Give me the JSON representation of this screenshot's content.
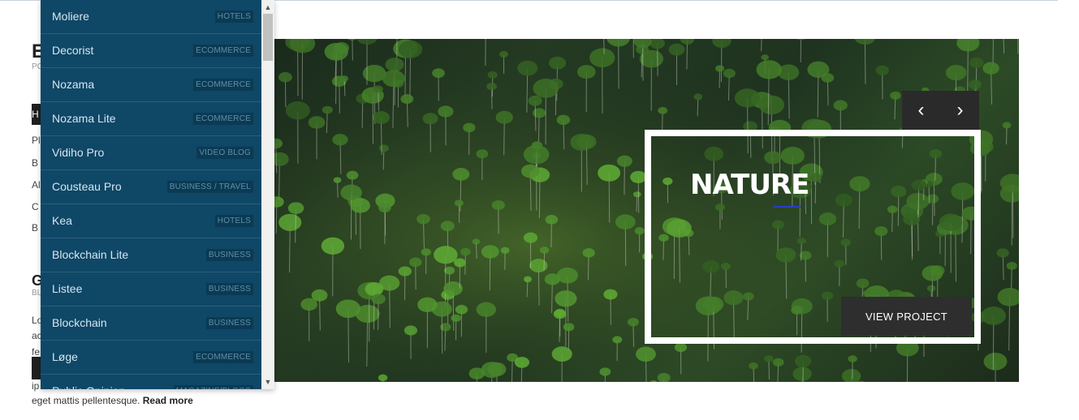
{
  "background": {
    "title_fragment": "E",
    "sub_fragment": "PO",
    "dark_fragment": "H",
    "lines": [
      "Pl",
      "B",
      "Al",
      "C",
      "B"
    ],
    "section_fragment": "G",
    "section_sub": "BL",
    "para_lines": [
      "Lo",
      "ac",
      "fe"
    ],
    "para_tail": "ip",
    "footer_text": "eget mattis pellentesque.",
    "read_more": "Read more"
  },
  "dropdown": {
    "items": [
      {
        "name": "Moliere",
        "tag": "HOTELS"
      },
      {
        "name": "Decorist",
        "tag": "ECOMMERCE"
      },
      {
        "name": "Nozama",
        "tag": "ECOMMERCE"
      },
      {
        "name": "Nozama Lite",
        "tag": "ECOMMERCE"
      },
      {
        "name": "Vidiho Pro",
        "tag": "VIDEO BLOG"
      },
      {
        "name": "Cousteau Pro",
        "tag": "BUSINESS / TRAVEL"
      },
      {
        "name": "Kea",
        "tag": "HOTELS"
      },
      {
        "name": "Blockchain Lite",
        "tag": "BUSINESS"
      },
      {
        "name": "Listee",
        "tag": "BUSINESS"
      },
      {
        "name": "Blockchain",
        "tag": "BUSINESS"
      },
      {
        "name": "Løge",
        "tag": "ECOMMERCE"
      },
      {
        "name": "Public Opinion",
        "tag": "MAGAZINE/BLOGS"
      }
    ],
    "scroll_up_icon": "chevron-up-icon",
    "scroll_down_icon": "chevron-down-icon"
  },
  "hero": {
    "prev_icon": "chevron-left-icon",
    "next_icon": "chevron-right-icon",
    "prev_glyph": "‹",
    "next_glyph": "›",
    "card_title": "NATURE",
    "cta_label": "VIEW PROJECT",
    "accent_color": "#2c3cc8"
  },
  "colors": {
    "dropdown_bg": "#0f4766",
    "dropdown_text": "#d5e6f1",
    "tag_bg": "#0b3a54",
    "button_bg": "#2e2e2e"
  }
}
